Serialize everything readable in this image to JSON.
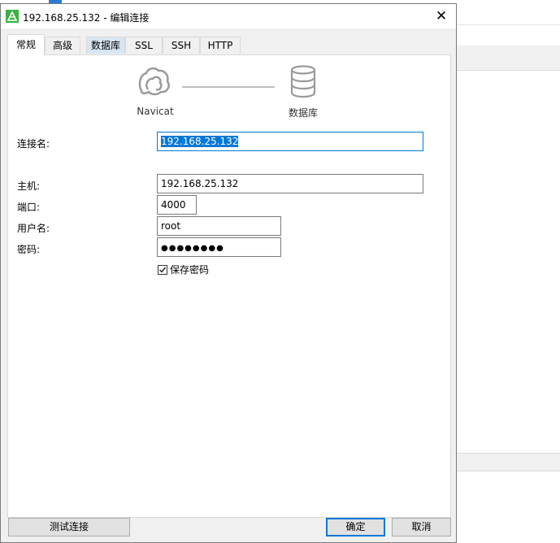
{
  "window": {
    "title": "192.168.25.132 - 编辑连接",
    "close_glyph": "✕"
  },
  "tabs": [
    {
      "label": "常规",
      "active": true
    },
    {
      "label": "高级"
    },
    {
      "label": "数据库",
      "highlighted": true
    },
    {
      "label": "SSL"
    },
    {
      "label": "SSH"
    },
    {
      "label": "HTTP"
    }
  ],
  "header": {
    "left_label": "Navicat",
    "right_label": "数据库",
    "left_icon": "navicat-icon",
    "right_icon": "database-icon"
  },
  "form": {
    "connection_name_label": "连接名:",
    "connection_name_value": "192.168.25.132",
    "host_label": "主机:",
    "host_value": "192.168.25.132",
    "port_label": "端口:",
    "port_value": "4000",
    "username_label": "用户名:",
    "username_value": "root",
    "password_label": "密码:",
    "password_value": "●●●●●●●●",
    "save_password_label": "保存密码",
    "save_password_checked": true
  },
  "buttons": {
    "test_connection": "测试连接",
    "ok": "确定",
    "cancel": "取消"
  },
  "colors": {
    "accent": "#0078d7",
    "tab_highlight": "#d8e6f2",
    "dialog_bg": "#f0f0f0"
  }
}
